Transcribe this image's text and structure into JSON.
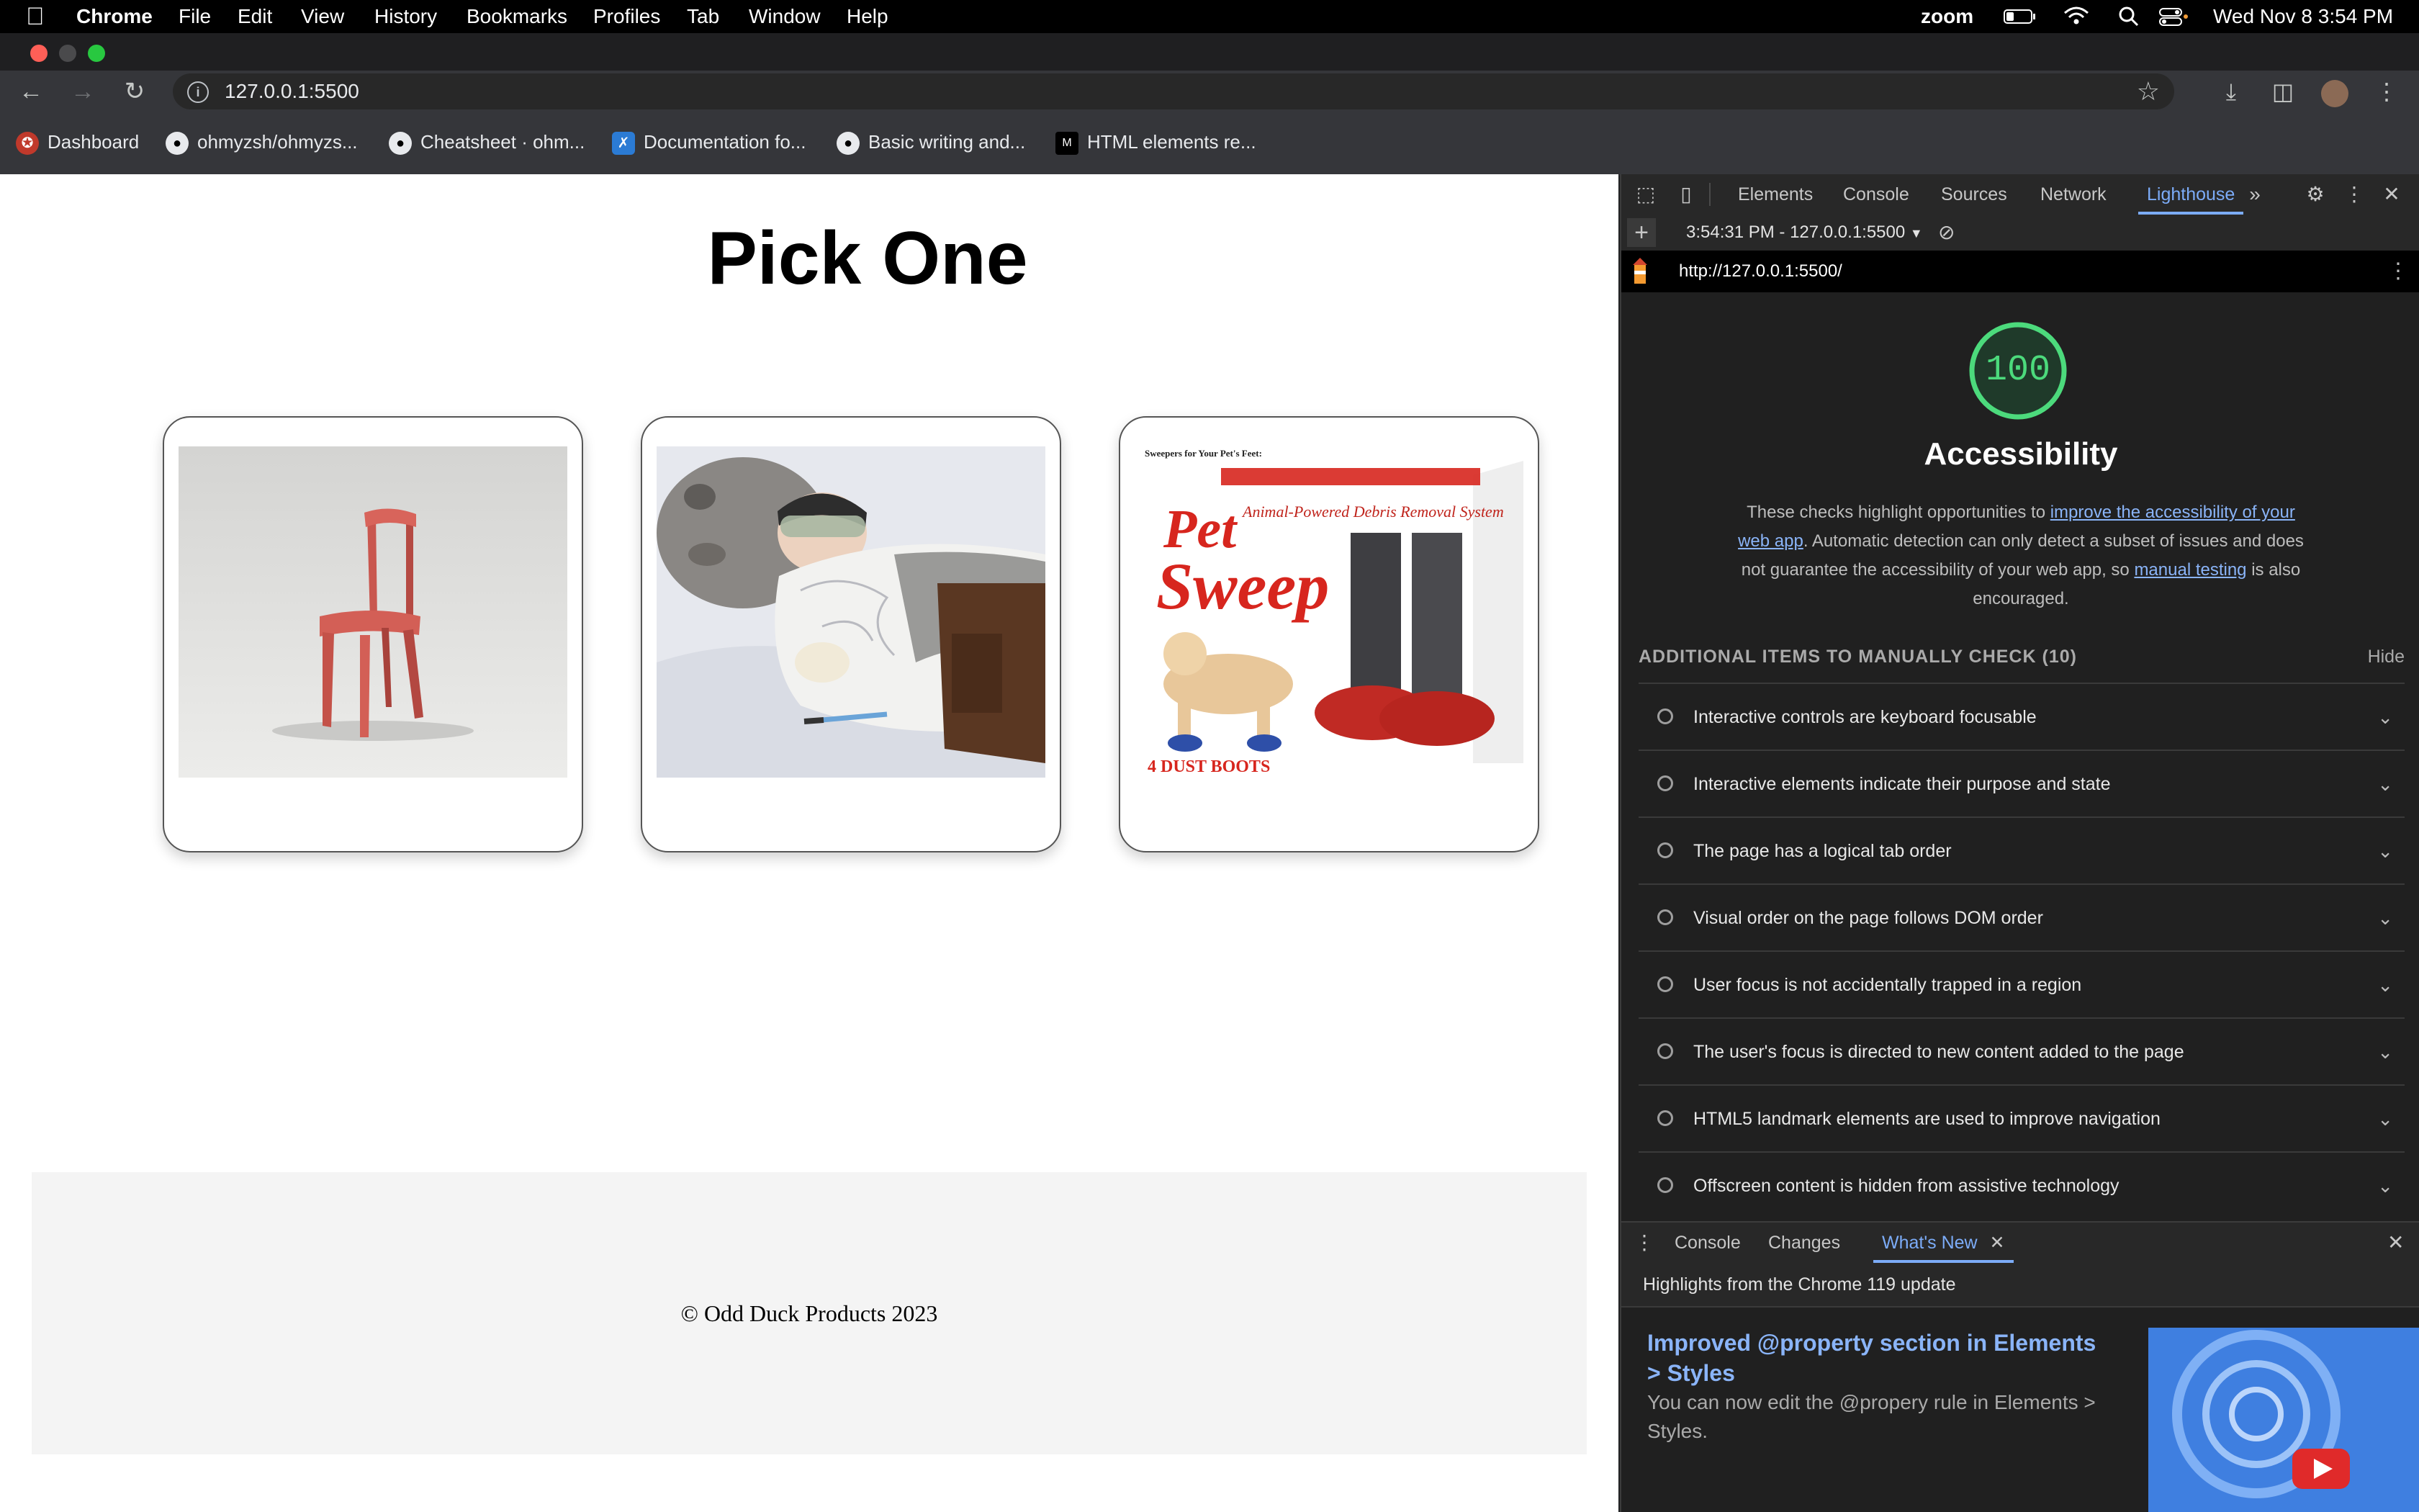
{
  "menubar": {
    "app": "Chrome",
    "items": [
      "File",
      "Edit",
      "View",
      "History",
      "Bookmarks",
      "Profiles",
      "Tab",
      "Window",
      "Help"
    ],
    "zoom": "zoom",
    "datetime": "Wed Nov 8  3:54 PM"
  },
  "browser": {
    "url": "127.0.0.1:5500",
    "bookmarks": [
      {
        "label": "Dashboard",
        "icon": "dashboard-icon"
      },
      {
        "label": "ohmyzsh/ohmyzs...",
        "icon": "github-icon"
      },
      {
        "label": "Cheatsheet · ohm...",
        "icon": "github-icon"
      },
      {
        "label": "Documentation fo...",
        "icon": "vscode-icon"
      },
      {
        "label": "Basic writing and...",
        "icon": "github-icon"
      },
      {
        "label": "HTML elements re...",
        "icon": "mdn-icon"
      }
    ]
  },
  "page": {
    "title": "Pick One",
    "products": [
      {
        "name": "chair",
        "alt": "red chair"
      },
      {
        "name": "tauntaun",
        "alt": "tauntaun sleeping bag"
      },
      {
        "name": "pet-sweep",
        "alt": "pet sweep"
      }
    ],
    "pet_sweep_box": {
      "tagline": "Sweepers for Your Pet's Feet:",
      "brand_line1": "Pet",
      "brand_line2": "Sweep",
      "sub": "Animal-Powered Debris Removal System",
      "boots": "4 DUST BOOTS"
    },
    "footer": "© Odd Duck Products 2023"
  },
  "devtools": {
    "tabs": [
      "Elements",
      "Console",
      "Sources",
      "Network",
      "Lighthouse"
    ],
    "active_tab": "Lighthouse",
    "report_selector": "3:54:31 PM - 127.0.0.1:5500",
    "report_url": "http://127.0.0.1:5500/",
    "score": "100",
    "category": "Accessibility",
    "desc_before": "These checks highlight opportunities to ",
    "desc_link1": "improve the accessibility of your web app",
    "desc_mid": ". Automatic detection can only detect a subset of issues and does not guarantee the accessibility of your web app, so ",
    "desc_link2": "manual testing",
    "desc_after": " is also encouraged.",
    "manual_header": "ADDITIONAL ITEMS TO MANUALLY CHECK (10)",
    "hide": "Hide",
    "audits": [
      "Interactive controls are keyboard focusable",
      "Interactive elements indicate their purpose and state",
      "The page has a logical tab order",
      "Visual order on the page follows DOM order",
      "User focus is not accidentally trapped in a region",
      "The user's focus is directed to new content added to the page",
      "HTML5 landmark elements are used to improve navigation",
      "Offscreen content is hidden from assistive technology"
    ],
    "drawer_tabs": [
      "Console",
      "Changes",
      "What's New"
    ],
    "drawer_active": "What's New",
    "whatsnew_header": "Highlights from the Chrome 119 update",
    "feature_title": "Improved @property section in Elements > Styles",
    "feature_desc": "You can now edit the @propery rule in Elements > Styles."
  },
  "colors": {
    "score_green": "#4cda7c",
    "link_blue": "#8ab4f8",
    "active_tab": "#7cacf8"
  }
}
